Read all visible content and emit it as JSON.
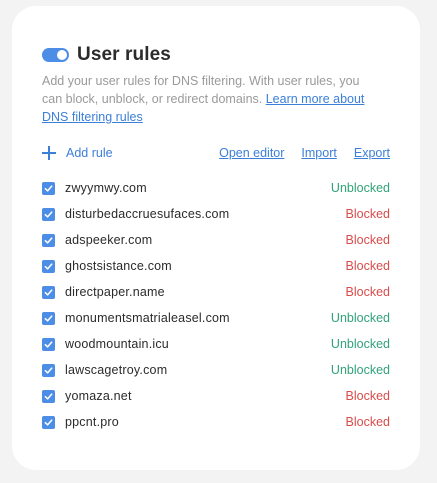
{
  "header": {
    "title": "User rules",
    "toggle_on": true
  },
  "description": {
    "text": "Add your user rules for DNS filtering. With user rules, you can block, unblock, or redirect domains. ",
    "link": "Learn more about DNS filtering rules"
  },
  "actions": {
    "add_rule": "Add rule",
    "open_editor": "Open editor",
    "import": "Import",
    "export": "Export"
  },
  "colors": {
    "accent": "#4c8de6",
    "link": "#3c7fd9",
    "unblocked": "#32a37a",
    "blocked": "#d94c4c"
  },
  "rules": [
    {
      "domain": "zwyymwy.com",
      "status": "Unblocked",
      "checked": true
    },
    {
      "domain": "disturbedaccruesufaces.com",
      "status": "Blocked",
      "checked": true
    },
    {
      "domain": "adspeeker.com",
      "status": "Blocked",
      "checked": true
    },
    {
      "domain": "ghostsistance.com",
      "status": "Blocked",
      "checked": true
    },
    {
      "domain": "directpaper.name",
      "status": "Blocked",
      "checked": true
    },
    {
      "domain": "monumentsmatrialeasel.com",
      "status": "Unblocked",
      "checked": true
    },
    {
      "domain": "woodmountain.icu",
      "status": "Unblocked",
      "checked": true
    },
    {
      "domain": "lawscagetroy.com",
      "status": "Unblocked",
      "checked": true
    },
    {
      "domain": "yomaza.net",
      "status": "Blocked",
      "checked": true
    },
    {
      "domain": "ppcnt.pro",
      "status": "Blocked",
      "checked": true
    }
  ]
}
